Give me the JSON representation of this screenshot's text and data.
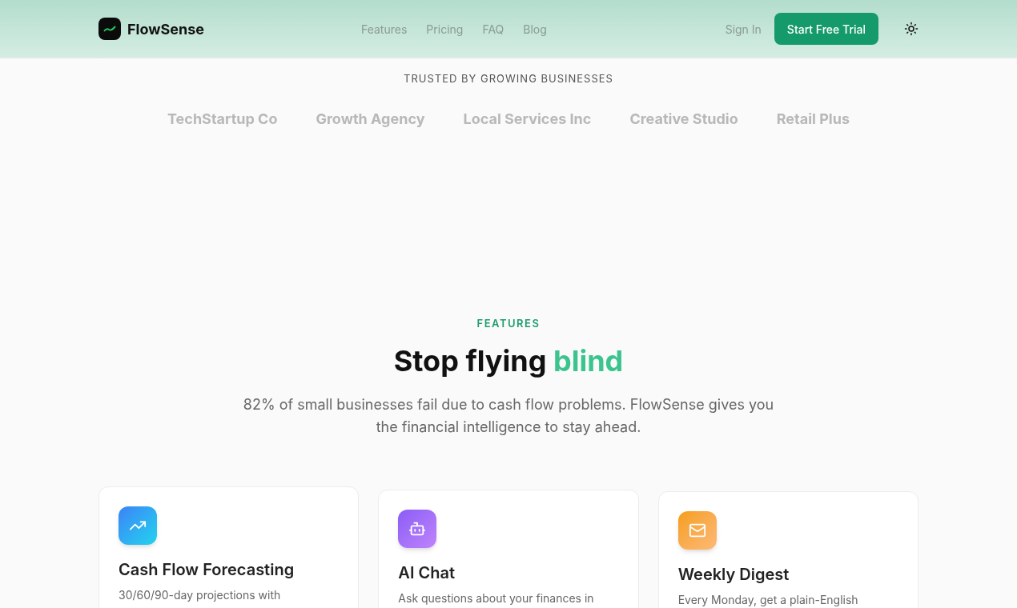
{
  "header": {
    "brand": "FlowSense",
    "nav": [
      {
        "label": "Features"
      },
      {
        "label": "Pricing"
      },
      {
        "label": "FAQ"
      },
      {
        "label": "Blog"
      }
    ],
    "sign_in": "Sign In",
    "cta": "Start Free Trial"
  },
  "trusted": {
    "heading": "TRUSTED BY GROWING BUSINESSES",
    "logos": [
      "TechStartup Co",
      "Growth Agency",
      "Local Services Inc",
      "Creative Studio",
      "Retail Plus"
    ]
  },
  "features": {
    "eyebrow": "FEATURES",
    "title": "Stop flying ",
    "title_accent": "blind",
    "subtitle": "82% of small businesses fail due to cash flow problems. FlowSense gives you the financial intelligence to stay ahead.",
    "cards": [
      {
        "kind": "trend",
        "title": "Cash Flow Forecasting",
        "text": "30/60/90-day projections with"
      },
      {
        "kind": "bot",
        "title": "AI Chat",
        "text": "Ask questions about your finances in"
      },
      {
        "kind": "mail",
        "title": "Weekly Digest",
        "text": "Every Monday, get a plain-English"
      }
    ]
  }
}
